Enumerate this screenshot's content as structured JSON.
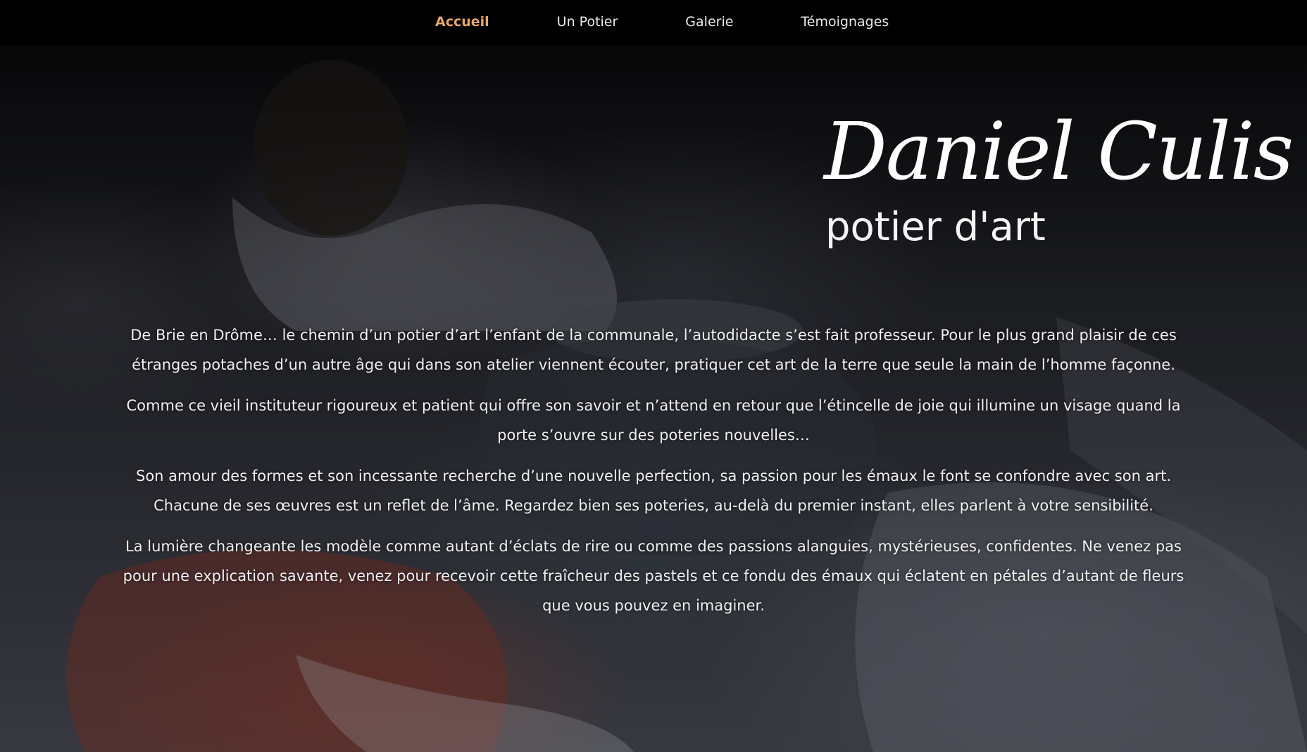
{
  "nav": {
    "items": [
      {
        "label": "Accueil",
        "active": true
      },
      {
        "label": "Un Potier",
        "active": false
      },
      {
        "label": "Galerie",
        "active": false
      },
      {
        "label": "Témoignages",
        "active": false
      }
    ]
  },
  "hero": {
    "name": "Daniel Culis",
    "subtitle": "potier d'art"
  },
  "content": {
    "paragraphs": [
      "De Brie en Drôme… le chemin d’un potier d’art l’enfant de la communale, l’autodidacte s’est fait professeur. Pour le plus grand plaisir de ces étranges potaches d’un autre âge qui dans son atelier viennent écouter, pratiquer cet art de la terre que seule la main de l’homme façonne.",
      "Comme ce vieil instituteur rigoureux et patient qui offre son savoir et n’attend en retour que l’étincelle de joie qui illumine un visage quand la porte s’ouvre sur des poteries nouvelles…",
      "Son amour des formes et son incessante recherche d’une nouvelle perfection, sa passion pour les émaux le font se confondre avec son art. Chacune de ses œuvres est un reflet de l’âme. Regardez bien ses poteries, au-delà du premier instant, elles parlent à votre sensibilité.",
      "La lumière changeante les modèle comme autant d’éclats de rire ou comme des passions alanguies, mystérieuses, confidentes. Ne venez pas pour une explication savante, venez pour recevoir cette fraîcheur des pastels et ce fondu des émaux qui éclatent en pétales d’autant de fleurs que vous pouvez en imaginer."
    ]
  },
  "colors": {
    "accent": "#e9a868",
    "nav_bg": "#000000",
    "text": "#f0f0f0"
  }
}
